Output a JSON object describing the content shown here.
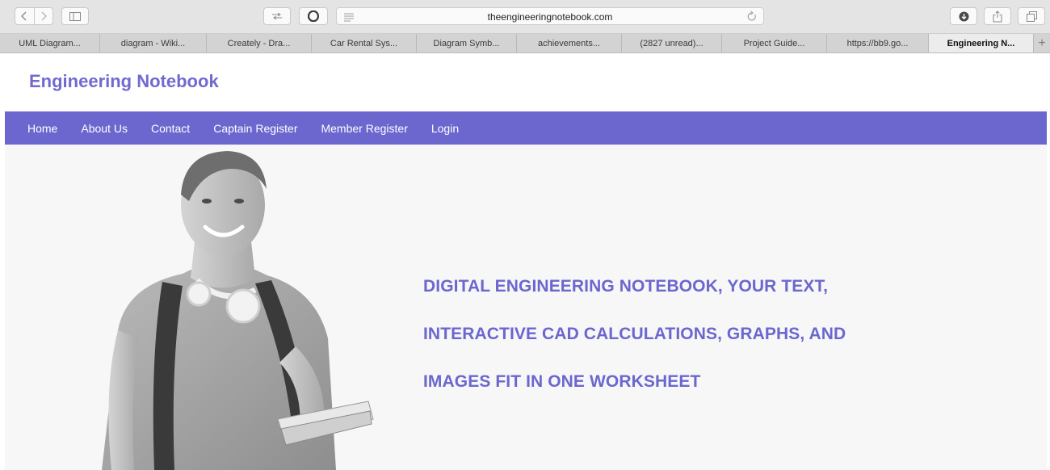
{
  "browser": {
    "url": "theengineeringnotebook.com",
    "tabs": [
      {
        "label": "UML Diagram..."
      },
      {
        "label": "diagram - Wiki..."
      },
      {
        "label": "Creately - Dra..."
      },
      {
        "label": "Car Rental Sys..."
      },
      {
        "label": "Diagram Symb..."
      },
      {
        "label": "achievements..."
      },
      {
        "label": "(2827 unread)..."
      },
      {
        "label": "Project Guide..."
      },
      {
        "label": "https://bb9.go..."
      },
      {
        "label": "Engineering N..."
      }
    ],
    "new_tab_label": "+"
  },
  "site": {
    "brand": "Engineering Notebook",
    "nav": [
      "Home",
      "About Us",
      "Contact",
      "Captain Register",
      "Member Register",
      "Login"
    ],
    "hero_lines": [
      "DIGITAL ENGINEERING NOTEBOOK, YOUR TEXT,",
      "INTERACTIVE CAD CALCULATIONS, GRAPHS, AND",
      "IMAGES FIT IN ONE WORKSHEET"
    ]
  },
  "colors": {
    "accent": "#6b67cf",
    "brand": "#6f6acf"
  },
  "icons": [
    "back-icon",
    "forward-icon",
    "sidebar-icon",
    "share-connection-icon",
    "opera-icon",
    "reader-icon",
    "reload-icon",
    "download-icon",
    "share-icon",
    "tabs-icon"
  ]
}
